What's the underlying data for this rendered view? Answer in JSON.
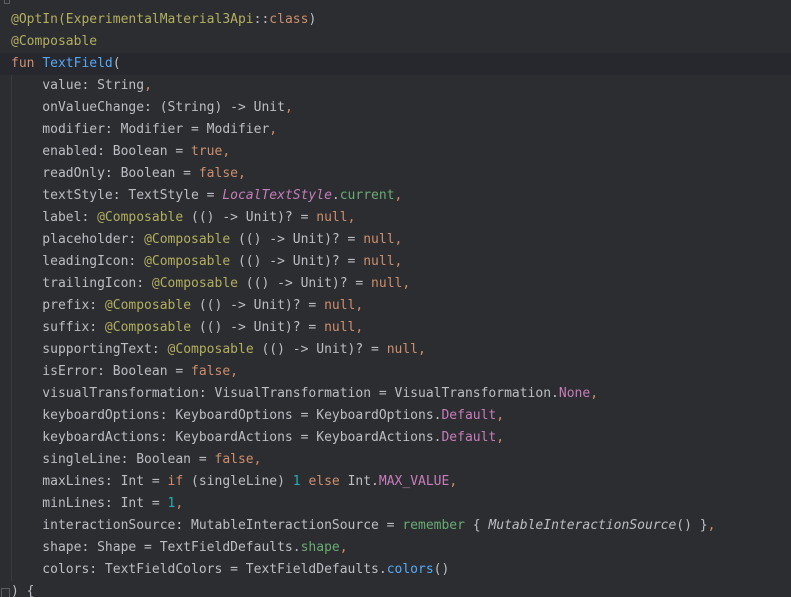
{
  "colors": {
    "background": "#2b2d30",
    "current_line": "#26282e",
    "annotation": "#b3ae60",
    "keyword": "#cf8e6d",
    "function_declaration": "#56a8f5",
    "default_text": "#bcbec4",
    "constant": "#c77dbb",
    "property": "#6aab73",
    "number": "#2aacb8"
  },
  "lines": [
    [
      {
        "t": "@OptIn(",
        "c": "annotation"
      },
      {
        "t": "ExperimentalMaterial3Api",
        "c": "annotation"
      },
      {
        "t": "::",
        "c": "default"
      },
      {
        "t": "class",
        "c": "keyword"
      },
      {
        "t": ")",
        "c": "default"
      }
    ],
    [
      {
        "t": "@Composable",
        "c": "annotation"
      }
    ],
    [
      {
        "t": "fun ",
        "c": "keyword"
      },
      {
        "t": "TextField",
        "c": "fn-decl"
      },
      {
        "t": "(",
        "c": "default"
      }
    ],
    [
      {
        "t": "    value: String",
        "c": "default"
      },
      {
        "t": ",",
        "c": "punct"
      }
    ],
    [
      {
        "t": "    onValueChange: (String) -> Unit",
        "c": "default"
      },
      {
        "t": ",",
        "c": "punct"
      }
    ],
    [
      {
        "t": "    modifier: Modifier = Modifier",
        "c": "default"
      },
      {
        "t": ",",
        "c": "punct"
      }
    ],
    [
      {
        "t": "    enabled: Boolean = ",
        "c": "default"
      },
      {
        "t": "true",
        "c": "keyword"
      },
      {
        "t": ",",
        "c": "punct"
      }
    ],
    [
      {
        "t": "    readOnly: Boolean = ",
        "c": "default"
      },
      {
        "t": "false",
        "c": "keyword"
      },
      {
        "t": ",",
        "c": "punct"
      }
    ],
    [
      {
        "t": "    textStyle: TextStyle = ",
        "c": "default"
      },
      {
        "t": "LocalTextStyle",
        "c": "italic"
      },
      {
        "t": ".",
        "c": "default"
      },
      {
        "t": "current",
        "c": "member"
      },
      {
        "t": ",",
        "c": "punct"
      }
    ],
    [
      {
        "t": "    label: ",
        "c": "default"
      },
      {
        "t": "@Composable",
        "c": "annotation"
      },
      {
        "t": " (() -> Unit)? = ",
        "c": "default"
      },
      {
        "t": "null",
        "c": "keyword"
      },
      {
        "t": ",",
        "c": "punct"
      }
    ],
    [
      {
        "t": "    placeholder: ",
        "c": "default"
      },
      {
        "t": "@Composable",
        "c": "annotation"
      },
      {
        "t": " (() -> Unit)? = ",
        "c": "default"
      },
      {
        "t": "null",
        "c": "keyword"
      },
      {
        "t": ",",
        "c": "punct"
      }
    ],
    [
      {
        "t": "    leadingIcon: ",
        "c": "default"
      },
      {
        "t": "@Composable",
        "c": "annotation"
      },
      {
        "t": " (() -> Unit)? = ",
        "c": "default"
      },
      {
        "t": "null",
        "c": "keyword"
      },
      {
        "t": ",",
        "c": "punct"
      }
    ],
    [
      {
        "t": "    trailingIcon: ",
        "c": "default"
      },
      {
        "t": "@Composable",
        "c": "annotation"
      },
      {
        "t": " (() -> Unit)? = ",
        "c": "default"
      },
      {
        "t": "null",
        "c": "keyword"
      },
      {
        "t": ",",
        "c": "punct"
      }
    ],
    [
      {
        "t": "    prefix: ",
        "c": "default"
      },
      {
        "t": "@Composable",
        "c": "annotation"
      },
      {
        "t": " (() -> Unit)? = ",
        "c": "default"
      },
      {
        "t": "null",
        "c": "keyword"
      },
      {
        "t": ",",
        "c": "punct"
      }
    ],
    [
      {
        "t": "    suffix: ",
        "c": "default"
      },
      {
        "t": "@Composable",
        "c": "annotation"
      },
      {
        "t": " (() -> Unit)? = ",
        "c": "default"
      },
      {
        "t": "null",
        "c": "keyword"
      },
      {
        "t": ",",
        "c": "punct"
      }
    ],
    [
      {
        "t": "    supportingText: ",
        "c": "default"
      },
      {
        "t": "@Composable",
        "c": "annotation"
      },
      {
        "t": " (() -> Unit)? = ",
        "c": "default"
      },
      {
        "t": "null",
        "c": "keyword"
      },
      {
        "t": ",",
        "c": "punct"
      }
    ],
    [
      {
        "t": "    isError: Boolean = ",
        "c": "default"
      },
      {
        "t": "false",
        "c": "keyword"
      },
      {
        "t": ",",
        "c": "punct"
      }
    ],
    [
      {
        "t": "    visualTransformation: VisualTransformation = VisualTransformation.",
        "c": "default"
      },
      {
        "t": "None",
        "c": "const"
      },
      {
        "t": ",",
        "c": "punct"
      }
    ],
    [
      {
        "t": "    keyboardOptions: KeyboardOptions = KeyboardOptions.",
        "c": "default"
      },
      {
        "t": "Default",
        "c": "const"
      },
      {
        "t": ",",
        "c": "punct"
      }
    ],
    [
      {
        "t": "    keyboardActions: KeyboardActions = KeyboardActions.",
        "c": "default"
      },
      {
        "t": "Default",
        "c": "const"
      },
      {
        "t": ",",
        "c": "punct"
      }
    ],
    [
      {
        "t": "    singleLine: Boolean = ",
        "c": "default"
      },
      {
        "t": "false",
        "c": "keyword"
      },
      {
        "t": ",",
        "c": "punct"
      }
    ],
    [
      {
        "t": "    maxLines: Int = ",
        "c": "default"
      },
      {
        "t": "if",
        "c": "keyword"
      },
      {
        "t": " (singleLine) ",
        "c": "default"
      },
      {
        "t": "1",
        "c": "number"
      },
      {
        "t": " ",
        "c": "default"
      },
      {
        "t": "else",
        "c": "keyword"
      },
      {
        "t": " Int.",
        "c": "default"
      },
      {
        "t": "MAX_VALUE",
        "c": "const"
      },
      {
        "t": ",",
        "c": "punct"
      }
    ],
    [
      {
        "t": "    minLines: Int = ",
        "c": "default"
      },
      {
        "t": "1",
        "c": "number"
      },
      {
        "t": ",",
        "c": "punct"
      }
    ],
    [
      {
        "t": "    interactionSource: MutableInteractionSource = ",
        "c": "default"
      },
      {
        "t": "remember",
        "c": "member"
      },
      {
        "t": " { ",
        "c": "default"
      },
      {
        "t": "MutableInteractionSource",
        "c": "italic-plain"
      },
      {
        "t": "() }",
        "c": "default"
      },
      {
        "t": ",",
        "c": "punct"
      }
    ],
    [
      {
        "t": "    shape: Shape = TextFieldDefaults.",
        "c": "default"
      },
      {
        "t": "shape",
        "c": "member"
      },
      {
        "t": ",",
        "c": "punct"
      }
    ],
    [
      {
        "t": "    colors: TextFieldColors = TextFieldDefaults.",
        "c": "default"
      },
      {
        "t": "colors",
        "c": "call"
      },
      {
        "t": "()",
        "c": "default"
      }
    ],
    [
      {
        "t": ") {",
        "c": "default"
      }
    ]
  ]
}
